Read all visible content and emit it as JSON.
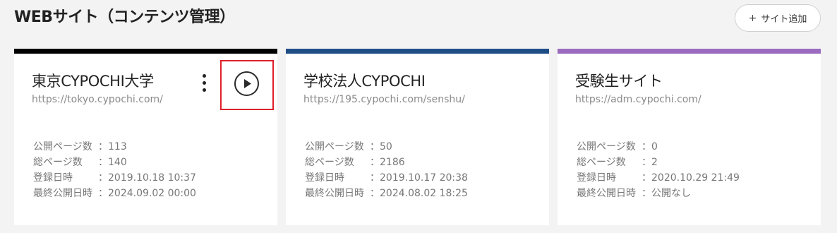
{
  "header": {
    "title": "WEBサイト（コンテンツ管理）",
    "add_button_label": "サイト追加",
    "add_icon": "plus-icon"
  },
  "cards": [
    {
      "name": "東京CYPOCHI大学",
      "url": "https://tokyo.cypochi.com/",
      "accent_color": "#000000",
      "stats": [
        {
          "label": "公開ページ数",
          "value": "113"
        },
        {
          "label": "総ページ数",
          "value": "140"
        },
        {
          "label": "登録日時",
          "value": "2019.10.18 10:37"
        },
        {
          "label": "最終公開日時",
          "value": "2024.09.02 00:00"
        }
      ]
    },
    {
      "name": "学校法人CYPOCHI",
      "url": "https://195.cypochi.com/senshu/",
      "accent_color": "#1f4e87",
      "stats": [
        {
          "label": "公開ページ数",
          "value": "50"
        },
        {
          "label": "総ページ数",
          "value": "2186"
        },
        {
          "label": "登録日時",
          "value": "2019.10.17 20:38"
        },
        {
          "label": "最終公開日時",
          "value": "2024.08.02 18:25"
        }
      ]
    },
    {
      "name": "受験生サイト",
      "url": "https://adm.cypochi.com/",
      "accent_color": "#9b6bbf",
      "stats": [
        {
          "label": "公開ページ数",
          "value": "0"
        },
        {
          "label": "総ページ数",
          "value": "2"
        },
        {
          "label": "登録日時",
          "value": "2020.10.29 21:49"
        },
        {
          "label": "最終公開日時",
          "value": "公開なし"
        }
      ]
    }
  ],
  "separator": "：",
  "highlight_color": "#e0202c"
}
